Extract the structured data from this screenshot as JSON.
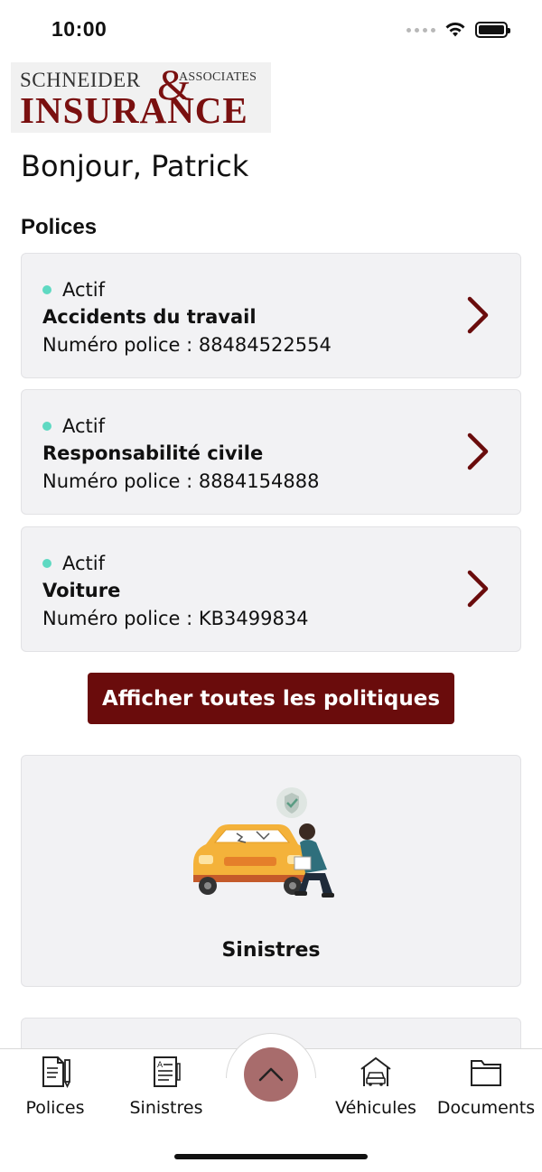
{
  "status_bar": {
    "time": "10:00"
  },
  "logo": {
    "line1": "SCHNEIDER",
    "amp": "&",
    "associates": "ASSOCIATES",
    "line2": "INSURANCE"
  },
  "greeting": "Bonjour, Patrick",
  "policies_section": {
    "title": "Polices",
    "items": [
      {
        "status": "Actif",
        "name": "Accidents du travail",
        "number": "Numéro police : 88484522554"
      },
      {
        "status": "Actif",
        "name": "Responsabilité civile",
        "number": "Numéro police : 8884154888"
      },
      {
        "status": "Actif",
        "name": "Voiture",
        "number": "Numéro police : KB3499834"
      }
    ],
    "show_all_label": "Afficher toutes les politiques"
  },
  "claims_card": {
    "title": "Sinistres"
  },
  "tab_bar": {
    "items": [
      {
        "label": "Polices",
        "icon": "policy-document-icon"
      },
      {
        "label": "Sinistres",
        "icon": "claims-document-icon"
      },
      {
        "label": "Véhicules",
        "icon": "car-garage-icon"
      },
      {
        "label": "Documents",
        "icon": "folder-icon"
      }
    ],
    "center_icon": "chevron-up-icon"
  },
  "colors": {
    "brand": "#6a0c0c",
    "active_dot": "#5fd9c2",
    "card_bg": "#f2f2f4",
    "center_button": "#a86c6c"
  }
}
